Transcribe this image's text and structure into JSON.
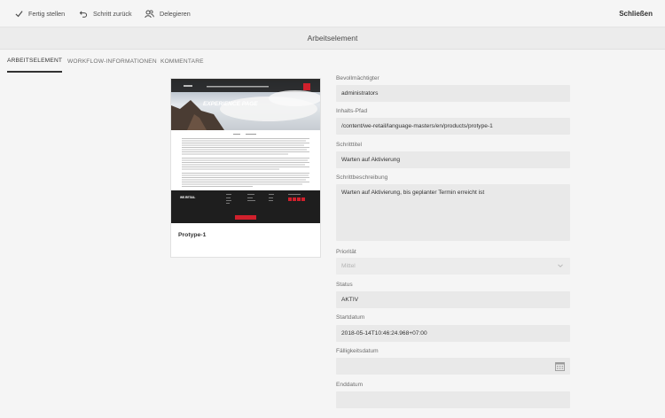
{
  "toolbar": {
    "complete_label": "Fertig stellen",
    "step_back_label": "Schritt zurück",
    "delegate_label": "Delegieren",
    "close_label": "Schließen"
  },
  "page": {
    "title": "Arbeitselement"
  },
  "tabs": [
    {
      "label": "ARBEITSELEMENT",
      "active": true
    },
    {
      "label": "WORKFLOW-INFORMATIONEN",
      "active": false
    },
    {
      "label": "KOMMENTARE",
      "active": false
    }
  ],
  "card": {
    "title": "Protype-1",
    "preview_headline": "EXPERIENCE PAGE",
    "preview_logo": "WE.RETAIL"
  },
  "form": {
    "assignee": {
      "label": "Bevollmächtigter",
      "value": "administrators"
    },
    "payload": {
      "label": "Inhalts-Pfad",
      "value": "/content/we-retail/language-masters/en/products/protype-1"
    },
    "step_title": {
      "label": "Schritttitel",
      "value": "Warten auf Aktivierung"
    },
    "step_description": {
      "label": "Schrittbeschreibung",
      "value": "Warten auf Aktivierung, bis geplanter Termin erreicht ist"
    },
    "priority": {
      "label": "Priorität",
      "value": "Mittel"
    },
    "status": {
      "label": "Status",
      "value": "AKTIV"
    },
    "start_date": {
      "label": "Startdatum",
      "value": "2018-05-14T10:46:24.968+07:00"
    },
    "due_date": {
      "label": "Fälligkeitsdatum",
      "value": ""
    },
    "end_date": {
      "label": "Enddatum",
      "value": ""
    }
  },
  "colors": {
    "accent_red": "#d0202c",
    "dark_footer": "#1e1e1e",
    "field_bg": "#e9e9e9"
  }
}
